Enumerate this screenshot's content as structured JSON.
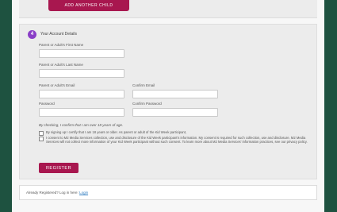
{
  "top_button": {
    "label": "ADD ANOTHER CHILD"
  },
  "form": {
    "step_number": "4",
    "title": "Your Account Details",
    "first_name_label": "Parent or Adult's First Name",
    "last_name_label": "Parent or Adult's Last Name",
    "email_label": "Parent or Adult's Email",
    "confirm_email_label": "Confirm Email",
    "password_label": "Password",
    "confirm_password_label": "Confirm Password",
    "age_note": "By checking, I confirm that I am over 18 years of age.",
    "checkbox_1": "By signing up I certify that I am 18 years or older. As parent or adult of the Kid Week participant,",
    "checkbox_2": "I consent to M2 Media Services collection, use and disclosure of the Kid Week participant's information. My consent is required for such collection, use and disclosure. M2 Media Services will not collect more information of your Kid Week participant without such consent. To learn more about M2 Media Services' information practices, see our privacy policy.",
    "register_label": "REGISTER"
  },
  "signin": {
    "text": "Already Registered? Log in here:",
    "link": "Login"
  },
  "colors": {
    "background": "#1e5240",
    "brand_button": "#a8174f",
    "step_badge": "#8a3fc7",
    "link": "#2e7bbf"
  }
}
